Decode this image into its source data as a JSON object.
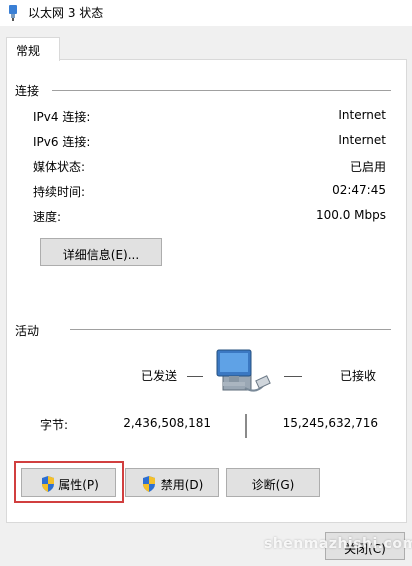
{
  "window": {
    "title": "以太网 3 状态",
    "icon": "ethernet-plug-icon"
  },
  "tabs": [
    {
      "label": "常规",
      "active": true
    }
  ],
  "connection": {
    "group_label": "连接",
    "rows": [
      {
        "label": "IPv4 连接:",
        "value": "Internet"
      },
      {
        "label": "IPv6 连接:",
        "value": "Internet"
      },
      {
        "label": "媒体状态:",
        "value": "已启用"
      },
      {
        "label": "持续时间:",
        "value": "02:47:45"
      },
      {
        "label": "速度:",
        "value": "100.0 Mbps"
      }
    ],
    "details_button": "详细信息(E)..."
  },
  "activity": {
    "group_label": "活动",
    "sent_label": "已发送",
    "received_label": "已接收",
    "bytes_label": "字节:",
    "bytes_sent": "2,436,508,181",
    "bytes_received": "15,245,632,716",
    "icon": "network-computer-icon"
  },
  "buttons": {
    "properties": "属性(P)",
    "disable": "禁用(D)",
    "diagnose": "诊断(G)",
    "close": "关闭(C)"
  },
  "highlight_color": "#d13f3f",
  "watermark": "shenmazhishi.com"
}
